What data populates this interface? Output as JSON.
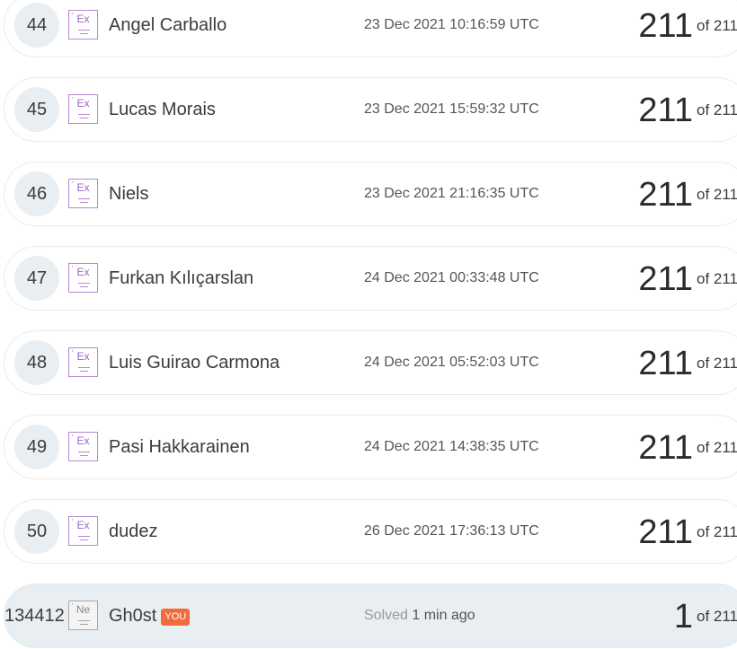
{
  "leaderboard": {
    "rows": [
      {
        "rank": "44",
        "element": "Ex",
        "name": "Angel Carballo",
        "date": "23 Dec 2021 10:16:59 UTC",
        "score": "211",
        "of": "of 211"
      },
      {
        "rank": "45",
        "element": "Ex",
        "name": "Lucas Morais",
        "date": "23 Dec 2021 15:59:32 UTC",
        "score": "211",
        "of": "of 211"
      },
      {
        "rank": "46",
        "element": "Ex",
        "name": "Niels",
        "date": "23 Dec 2021 21:16:35 UTC",
        "score": "211",
        "of": "of 211"
      },
      {
        "rank": "47",
        "element": "Ex",
        "name": "Furkan Kılıçarslan",
        "date": "24 Dec 2021 00:33:48 UTC",
        "score": "211",
        "of": "of 211"
      },
      {
        "rank": "48",
        "element": "Ex",
        "name": "Luis Guirao Carmona",
        "date": "24 Dec 2021 05:52:03 UTC",
        "score": "211",
        "of": "of 211"
      },
      {
        "rank": "49",
        "element": "Ex",
        "name": "Pasi Hakkarainen",
        "date": "24 Dec 2021 14:38:35 UTC",
        "score": "211",
        "of": "of 211"
      },
      {
        "rank": "50",
        "element": "Ex",
        "name": "dudez",
        "date": "26 Dec 2021 17:36:13 UTC",
        "score": "211",
        "of": "of 211"
      }
    ],
    "self": {
      "rank": "134412",
      "element": "Ne",
      "name": "Gh0st",
      "you_label": "YOU",
      "solved_label": "Solved",
      "solved_ago": "1 min ago",
      "score": "1",
      "of": "of 211"
    }
  },
  "colors": {
    "badge_expert": "#b58ad1",
    "badge_newbie": "#a9a9a9",
    "you_tag": "#f26b3a",
    "rank_circle": "#e9eef2"
  },
  "icons": {
    "expert_badge": "element-badge-ex-icon",
    "newbie_badge": "element-badge-ne-icon"
  }
}
